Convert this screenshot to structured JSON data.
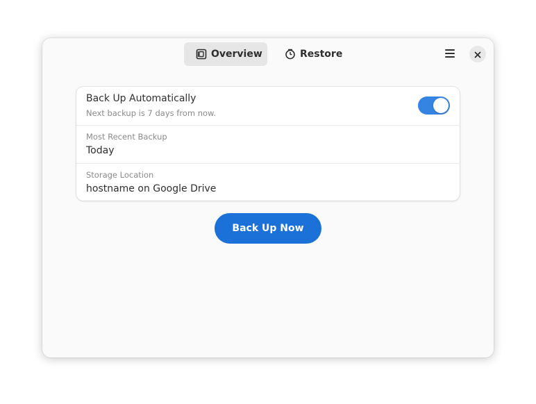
{
  "header": {
    "tabs": [
      {
        "label": "Overview",
        "icon": "overview-icon",
        "active": true
      },
      {
        "label": "Restore",
        "icon": "clock-icon",
        "active": false
      }
    ],
    "menu_icon": "hamburger-menu-icon",
    "close_icon": "close-icon"
  },
  "settings": {
    "auto_backup": {
      "title": "Back Up Automatically",
      "subtitle": "Next backup is 7 days from now.",
      "enabled": true
    },
    "recent_backup": {
      "label": "Most Recent Backup",
      "value": "Today"
    },
    "storage": {
      "label": "Storage Location",
      "value": "hostname on Google Drive"
    }
  },
  "actions": {
    "backup_now_label": "Back Up Now"
  },
  "colors": {
    "accent": "#3584e4",
    "primary_button": "#1c71d8",
    "window_bg": "#fafafa"
  }
}
